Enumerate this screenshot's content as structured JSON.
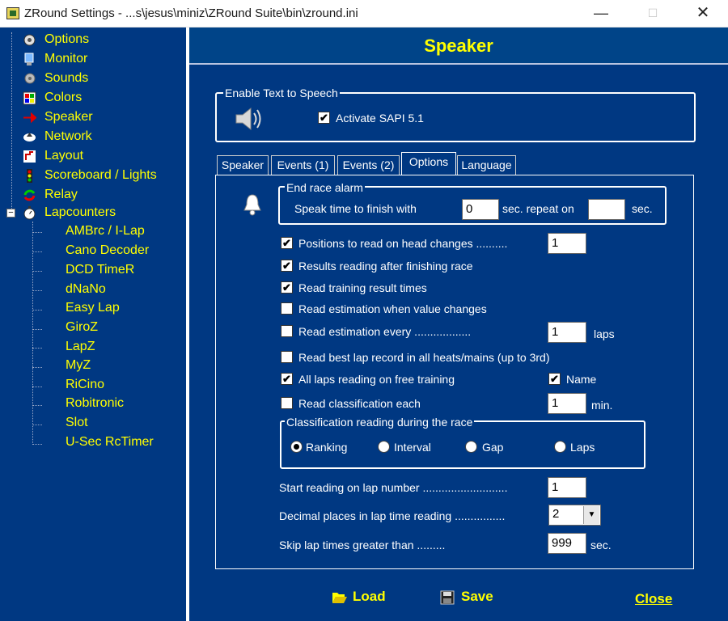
{
  "window": {
    "title": "ZRound Settings - ...s\\jesus\\miniz\\ZRound Suite\\bin\\zround.ini",
    "minimize": "—",
    "maximize": "☐",
    "close": "✕"
  },
  "sidebar": {
    "items": [
      {
        "label": "Options",
        "icon": "gears-icon"
      },
      {
        "label": "Monitor",
        "icon": "monitor-icon"
      },
      {
        "label": "Sounds",
        "icon": "sounds-icon"
      },
      {
        "label": "Colors",
        "icon": "colors-icon"
      },
      {
        "label": "Speaker",
        "icon": "red-arrow-icon"
      },
      {
        "label": "Network",
        "icon": "network-icon"
      },
      {
        "label": "Layout",
        "icon": "layout-icon"
      },
      {
        "label": "Scoreboard / Lights",
        "icon": "traffic-light-icon"
      },
      {
        "label": "Relay",
        "icon": "relay-icon"
      },
      {
        "label": "Lapcounters",
        "icon": "stopwatch-icon"
      }
    ],
    "lapcounters": [
      "AMBrc / I-Lap",
      "Cano Decoder",
      "DCD TimeR",
      "dNaNo",
      "Easy Lap",
      "GiroZ",
      "LapZ",
      "MyZ",
      "RiCino",
      "Robitronic",
      "Slot",
      "U-Sec RcTimer"
    ],
    "expander": "−"
  },
  "header": {
    "title": "Speaker"
  },
  "tts": {
    "group_title": "Enable Text to Speech",
    "activate_label": "Activate SAPI 5.1",
    "activate_checked": "✔"
  },
  "tabs": [
    "Speaker",
    "Events (1)",
    "Events (2)",
    "Options",
    "Language"
  ],
  "options": {
    "end_race_title": "End race alarm",
    "speak_time_label": "Speak time to finish with",
    "speak_time_value": "0",
    "repeat_label": "sec. repeat on",
    "repeat_value": "",
    "repeat_unit": "sec.",
    "check_mark": "✔",
    "rows": [
      {
        "label": "Positions to read on head changes ..........",
        "checked": true
      },
      {
        "label": "Results reading after finishing race",
        "checked": true
      },
      {
        "label": "Read training result times",
        "checked": true
      },
      {
        "label": "Read estimation when value changes",
        "checked": false
      },
      {
        "label": "Read estimation every ..................",
        "checked": false
      },
      {
        "label": "Read best lap record in all heats/mains (up to 3rd)",
        "checked": false
      },
      {
        "label": "All laps reading on free training",
        "checked": true
      },
      {
        "label": "Read classification each",
        "checked": false
      }
    ],
    "positions_value": "1",
    "estimation_value": "1",
    "estimation_unit": "laps",
    "name_label": "Name",
    "classification_value": "1",
    "classification_unit": "min.",
    "class_group_title": "Classification reading during the race",
    "radios": [
      "Ranking",
      "Interval",
      "Gap",
      "Laps"
    ],
    "start_reading_label": "Start reading on lap number ...........................",
    "start_reading_value": "1",
    "decimal_label": "Decimal places in lap time reading ................",
    "decimal_value": "2",
    "skip_label": "Skip lap times greater than .........",
    "skip_value": "999",
    "skip_unit": "sec."
  },
  "buttons": {
    "load": "Load",
    "save": "Save",
    "close": "Close"
  }
}
